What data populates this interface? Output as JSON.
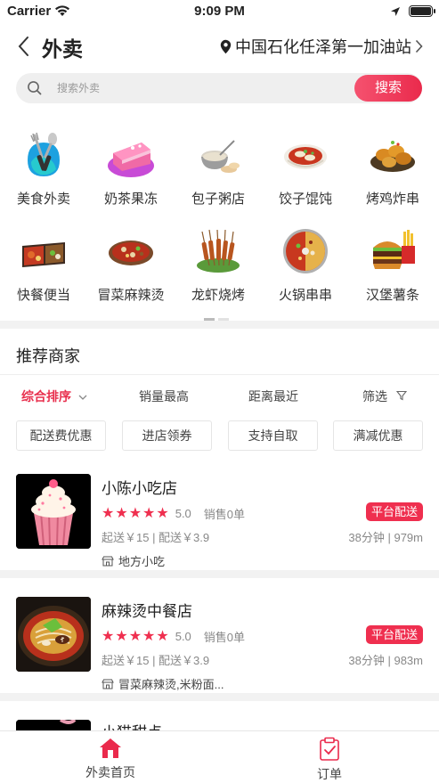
{
  "status_bar": {
    "carrier": "Carrier",
    "time": "9:09 PM"
  },
  "header": {
    "title": "外卖",
    "location": "中国石化任泽第一加油站"
  },
  "search": {
    "placeholder": "搜索外卖",
    "button": "搜索"
  },
  "categories": [
    {
      "label": "美食外卖",
      "icon": "fork-spoon-icon"
    },
    {
      "label": "奶茶果冻",
      "icon": "cake-icon"
    },
    {
      "label": "包子粥店",
      "icon": "porridge-bowl-icon"
    },
    {
      "label": "饺子馄饨",
      "icon": "dumpling-bowl-icon"
    },
    {
      "label": "烤鸡炸串",
      "icon": "fried-chicken-icon"
    },
    {
      "label": "快餐便当",
      "icon": "bento-box-icon"
    },
    {
      "label": "冒菜麻辣烫",
      "icon": "spicy-pot-icon"
    },
    {
      "label": "龙虾烧烤",
      "icon": "skewers-icon"
    },
    {
      "label": "火锅串串",
      "icon": "hotpot-icon"
    },
    {
      "label": "汉堡薯条",
      "icon": "burger-fries-icon"
    }
  ],
  "section_title": "推荐商家",
  "sorts": [
    {
      "label": "综合排序"
    },
    {
      "label": "销量最高"
    },
    {
      "label": "距离最近"
    },
    {
      "label": "筛选"
    }
  ],
  "filters": [
    {
      "label": "配送费优惠"
    },
    {
      "label": "进店领券"
    },
    {
      "label": "支持自取"
    },
    {
      "label": "满减优惠"
    }
  ],
  "shops": [
    {
      "name": "小陈小吃店",
      "stars": "★★★★★",
      "score": "5.0",
      "sales": "销售0单",
      "tag": "平台配送",
      "meta": "起送￥15 | 配送￥3.9",
      "distance": "38分钟 | 979m",
      "category": "地方小吃",
      "image": "cupcake"
    },
    {
      "name": "麻辣烫中餐店",
      "stars": "★★★★★",
      "score": "5.0",
      "sales": "销售0单",
      "tag": "平台配送",
      "meta": "起送￥15 | 配送￥3.9",
      "distance": "38分钟 | 983m",
      "category": "冒菜麻辣烫,米粉面...",
      "image": "noodle-pot"
    },
    {
      "name": "小猫甜点",
      "image": "dessert"
    }
  ],
  "tabbar": [
    {
      "label": "外卖首页",
      "icon": "home-icon",
      "active": true
    },
    {
      "label": "订单",
      "icon": "order-clipboard-icon",
      "active": false
    }
  ],
  "colors": {
    "accent": "#ea2a4c",
    "text": "#222222",
    "muted": "#888888",
    "divider": "#f2f2f2"
  }
}
